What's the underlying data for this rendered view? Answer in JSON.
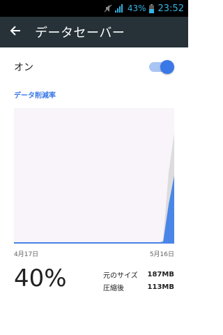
{
  "status_bar": {
    "battery_percent": "43%",
    "time": "23:52",
    "icons": [
      "mute-icon",
      "signal-icon",
      "battery-icon"
    ]
  },
  "app_bar": {
    "title": "データセーバー",
    "back_icon": "back-arrow-icon"
  },
  "toggle": {
    "label": "オン",
    "state": "on"
  },
  "section": {
    "title": "データ削減率"
  },
  "chart_data": {
    "type": "area",
    "x_start_label": "4月17日",
    "x_end_label": "5月16日",
    "x": [
      "4月17日",
      "5月16日"
    ],
    "series": [
      {
        "values": [
          0,
          0,
          0,
          0,
          0,
          0,
          0,
          0,
          0,
          0,
          0,
          0,
          0,
          0,
          0,
          0,
          0,
          0,
          0,
          0,
          0,
          0,
          0,
          0,
          0,
          0,
          0,
          0.02,
          0.55,
          0.85
        ]
      },
      {
        "values": [
          0,
          0,
          0,
          0,
          0,
          0,
          0,
          0,
          0,
          0,
          0,
          0,
          0,
          0,
          0,
          0,
          0,
          0,
          0,
          0,
          0,
          0,
          0,
          0,
          0,
          0,
          0,
          0.01,
          0.3,
          0.52
        ]
      }
    ],
    "ylim": [
      0,
      1
    ],
    "colors": {
      "original": "#dcdcdc",
      "compressed": "#4a86e8",
      "background": "#f8f4fa"
    }
  },
  "summary": {
    "percent": "40%",
    "original_label": "元のサイズ",
    "original_value": "187MB",
    "compressed_label": "圧縮後",
    "compressed_value": "113MB"
  },
  "colors": {
    "accent": "#3b78e7",
    "app_bar": "#263238",
    "status_text": "#33b5e5"
  }
}
